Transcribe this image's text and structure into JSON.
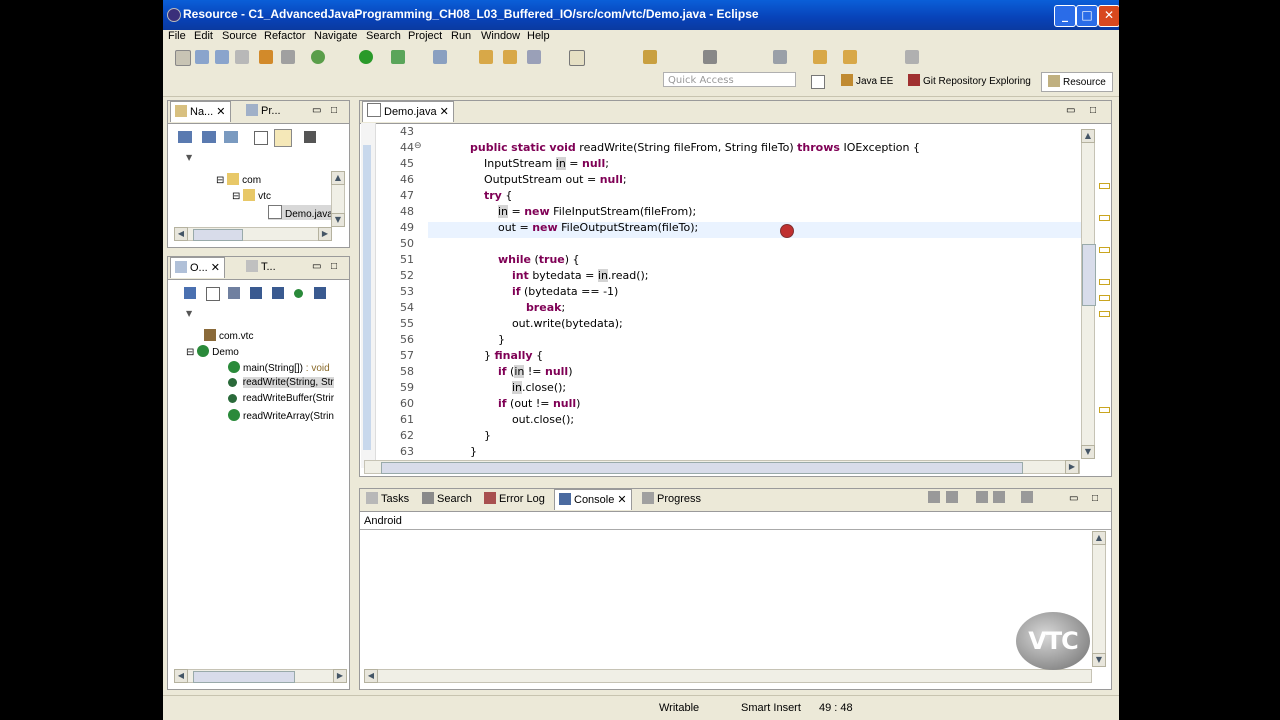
{
  "window": {
    "title": "Resource - C1_AdvancedJavaProgramming_CH08_L03_Buffered_IO/src/com/vtc/Demo.java - Eclipse",
    "controls": [
      "minimize",
      "maximize",
      "close"
    ]
  },
  "menu": [
    "File",
    "Edit",
    "Source",
    "Refactor",
    "Navigate",
    "Search",
    "Project",
    "Run",
    "Window",
    "Help"
  ],
  "quick_access": {
    "placeholder": "Quick Access"
  },
  "perspectives": [
    {
      "label": "Java EE",
      "icon": "javaee-perspective-icon"
    },
    {
      "label": "Git Repository Exploring",
      "icon": "git-perspective-icon"
    },
    {
      "label": "Resource",
      "icon": "resource-perspective-icon",
      "active": true
    }
  ],
  "navigator": {
    "tabs": [
      "Na...",
      "Pr..."
    ],
    "tree": [
      {
        "label": "com",
        "level": 1
      },
      {
        "label": "vtc",
        "level": 2
      },
      {
        "label": "Demo.java",
        "level": 3,
        "selected": true
      }
    ]
  },
  "outline": {
    "tabs": [
      "O...",
      "T..."
    ],
    "items": [
      {
        "label": "com.vtc",
        "type": "package"
      },
      {
        "label": "Demo",
        "type": "class"
      },
      {
        "label": "main(String[])",
        "suffix": " : void",
        "type": "method-public-static"
      },
      {
        "label": "readWrite(String, Str",
        "type": "method-private-static",
        "selected": true
      },
      {
        "label": "readWriteBuffer(Strir",
        "type": "method-private-static"
      },
      {
        "label": "readWriteArray(Strin",
        "type": "method-public-static"
      }
    ]
  },
  "editor": {
    "tab": "Demo.java",
    "current_line": 49,
    "lines": [
      {
        "n": "43",
        "code": ""
      },
      {
        "n": "44",
        "fold": true,
        "code": "    <k>public</k> <k>static</k> <k>void</k> readWrite(String fileFrom, String fileTo) <k>throws</k> IOException {"
      },
      {
        "n": "45",
        "code": "        InputStream <h>in</h> = <k>null</k>;"
      },
      {
        "n": "46",
        "code": "        OutputStream out = <k>null</k>;"
      },
      {
        "n": "47",
        "code": "        <k>try</k> {"
      },
      {
        "n": "48",
        "code": "            <h>in</h> = <k>new</k> FileInputStream(fileFrom);"
      },
      {
        "n": "49",
        "code": "            out = <k>new</k> FileOutputStream(fileTo);"
      },
      {
        "n": "50",
        "code": ""
      },
      {
        "n": "51",
        "code": "            <k>while</k> (<k>true</k>) {"
      },
      {
        "n": "52",
        "code": "                <k>int</k> bytedata = <h>in</h>.read();"
      },
      {
        "n": "53",
        "code": "                <k>if</k> (bytedata == -1)"
      },
      {
        "n": "54",
        "code": "                    <k>break</k>;"
      },
      {
        "n": "55",
        "code": "                out.write(bytedata);"
      },
      {
        "n": "56",
        "code": "            }"
      },
      {
        "n": "57",
        "code": "        } <k>finally</k> {"
      },
      {
        "n": "58",
        "code": "            <k>if</k> (<h>in</h> != <k>null</k>)"
      },
      {
        "n": "59",
        "code": "                <h>in</h>.close();"
      },
      {
        "n": "60",
        "code": "            <k>if</k> (out != <k>null</k>)"
      },
      {
        "n": "61",
        "code": "                out.close();"
      },
      {
        "n": "62",
        "code": "        }"
      },
      {
        "n": "63",
        "code": "    }"
      }
    ]
  },
  "bottom": {
    "tabs": [
      "Tasks",
      "Search",
      "Error Log",
      "Console",
      "Progress"
    ],
    "active_tab": "Console",
    "console_name": "Android"
  },
  "status": {
    "writable": "Writable",
    "insert_mode": "Smart Insert",
    "position": "49 : 48"
  },
  "watermark": "VTC"
}
